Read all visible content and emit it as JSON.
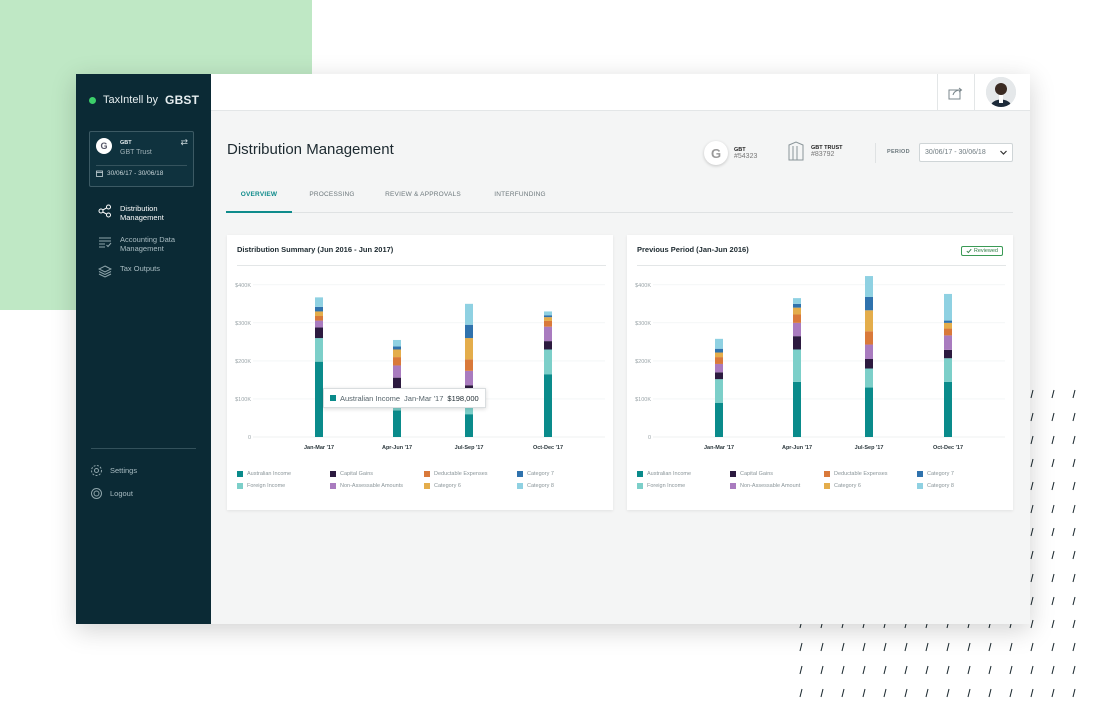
{
  "app": {
    "brand_name": "TaxIntell by",
    "brand_strong": "GBST",
    "entity": {
      "logo_letter": "G",
      "code": "GBT",
      "name": "GBT Trust",
      "dates": "30/06/17 - 30/06/18"
    },
    "nav": [
      {
        "label_line1": "Distribution",
        "label_line2": "Management",
        "icon": "share-network-icon",
        "active": true
      },
      {
        "label_line1": "Accounting Data",
        "label_line2": "Management",
        "icon": "list-check-icon",
        "active": false
      },
      {
        "label_line1": "Tax Outputs",
        "label_line2": "",
        "icon": "layers-icon",
        "active": false
      }
    ],
    "settings_label": "Settings",
    "logout_label": "Logout"
  },
  "header": {
    "title": "Distribution Management",
    "entity1": {
      "logo_letter": "G",
      "title": "GBT",
      "code": "#54323"
    },
    "entity2": {
      "title": "GBT TRUST",
      "code": "#83792"
    },
    "period_label": "PERIOD",
    "period_value": "30/06/17 - 30/06/18"
  },
  "tabs": [
    {
      "label": "OVERVIEW",
      "active": true
    },
    {
      "label": "PROCESSING",
      "active": false
    },
    {
      "label": "REVIEW & APPROVALS",
      "active": false
    },
    {
      "label": "INTERFUNDING",
      "active": false
    }
  ],
  "colors": {
    "Australian Income": "#0a8b8b",
    "Foreign Income": "#7ccfc9",
    "Capital Gains": "#2c1a3f",
    "Non-Assessable Amounts": "#a97bbf",
    "Deductable Expenses": "#d9793a",
    "Category 6": "#e4ad4b",
    "Category 7": "#2f72ad",
    "Category 8": "#8fd1e2"
  },
  "chart_data": [
    {
      "type": "bar",
      "stacked": true,
      "title": "Distribution Summary (Jun 2016 - Jun 2017)",
      "categories": [
        "Jan-Mar '17",
        "Apr-Jun '17",
        "Jul-Sep '17",
        "Oct-Dec '17"
      ],
      "y_ticks": [
        "0",
        "$100K",
        "$200K",
        "$300K",
        "$400K"
      ],
      "ylim": [
        0,
        410000
      ],
      "legend_labels": [
        "Australian Income",
        "Foreign Income",
        "Capital Gains",
        "Non-Assessable Amounts",
        "Deductable Expenses",
        "Category 6",
        "Category 7",
        "Category 8"
      ],
      "series": [
        {
          "name": "Australian Income",
          "values": [
            198000,
            70000,
            60000,
            165000
          ]
        },
        {
          "name": "Foreign Income",
          "values": [
            62000,
            48000,
            50000,
            65000
          ]
        },
        {
          "name": "Capital Gains",
          "values": [
            28000,
            38000,
            26000,
            22000
          ]
        },
        {
          "name": "Non-Assessable Amounts",
          "values": [
            18000,
            32000,
            38000,
            38000
          ]
        },
        {
          "name": "Deductable Expenses",
          "values": [
            12000,
            22000,
            30000,
            15000
          ]
        },
        {
          "name": "Category 6",
          "values": [
            12000,
            20000,
            56000,
            10000
          ]
        },
        {
          "name": "Category 7",
          "values": [
            12000,
            8000,
            35000,
            5000
          ]
        },
        {
          "name": "Category 8",
          "values": [
            25000,
            17000,
            55000,
            10000
          ]
        }
      ],
      "tooltip": {
        "series": "Australian Income",
        "category": "Jan-Mar '17",
        "value": "$198,000"
      }
    },
    {
      "type": "bar",
      "stacked": true,
      "title": "Previous Period (Jan-Jun 2016)",
      "badge": "Reviewed",
      "categories": [
        "Jan-Mar '17",
        "Apr-Jun '17",
        "Jul-Sep '17",
        "Oct-Dec '17"
      ],
      "y_ticks": [
        "0",
        "$100K",
        "$200K",
        "$300K",
        "$400K"
      ],
      "ylim": [
        0,
        410000
      ],
      "legend_labels": [
        "Australian Income",
        "Foreign Income",
        "Capital Gains",
        "Non-Assessable Amount",
        "Deductable Expenses",
        "Category 6",
        "Category 7",
        "Category 8"
      ],
      "series": [
        {
          "name": "Australian Income",
          "values": [
            90000,
            145000,
            130000,
            145000
          ]
        },
        {
          "name": "Foreign Income",
          "values": [
            62000,
            85000,
            50000,
            62000
          ]
        },
        {
          "name": "Capital Gains",
          "values": [
            18000,
            35000,
            25000,
            22000
          ]
        },
        {
          "name": "Non-Assessable Amount",
          "values": [
            22000,
            35000,
            38000,
            38000
          ]
        },
        {
          "name": "Deductable Expenses",
          "values": [
            18000,
            22000,
            35000,
            18000
          ]
        },
        {
          "name": "Category 6",
          "values": [
            12000,
            18000,
            55000,
            15000
          ]
        },
        {
          "name": "Category 7",
          "values": [
            10000,
            10000,
            35000,
            6000
          ]
        },
        {
          "name": "Category 8",
          "values": [
            26000,
            15000,
            55000,
            70000
          ]
        }
      ]
    }
  ]
}
